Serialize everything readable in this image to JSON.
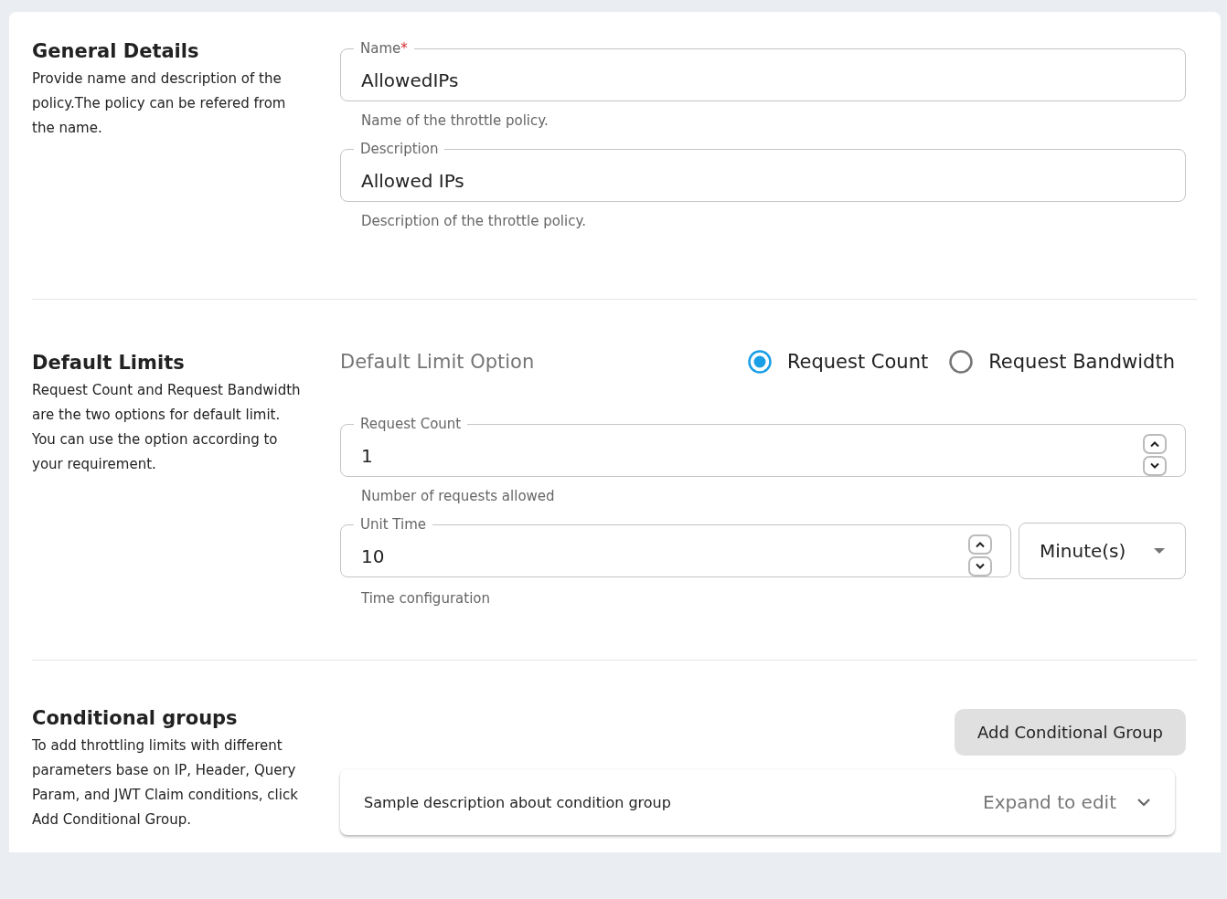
{
  "sections": [
    {
      "kind": "general",
      "title": "General Details",
      "description": "Provide name and description of the policy.The policy can be refered from the name.",
      "fields": [
        {
          "kind": "text",
          "label": "Name",
          "required_mark": "*",
          "value": "AllowedIPs",
          "helper": "Name of the throttle policy."
        },
        {
          "kind": "text",
          "label": "Description",
          "value": "Allowed IPs",
          "helper": "Description of the throttle policy."
        }
      ]
    },
    {
      "kind": "limits",
      "title": "Default Limits",
      "description": "Request Count and Request Bandwidth are the two options for default limit. You can use the option according to your requirement.",
      "radio_group": {
        "label": "Default Limit Option",
        "options": [
          {
            "label": "Request Count",
            "selected": true
          },
          {
            "label": "Request Bandwidth",
            "selected": false
          }
        ]
      },
      "fields": [
        {
          "kind": "number",
          "label": "Request Count",
          "value": "1",
          "helper": "Number of requests allowed"
        },
        {
          "kind": "number",
          "label": "Unit Time",
          "value": "10",
          "helper": "Time configuration",
          "unit": {
            "value": "Minute(s)"
          }
        }
      ]
    },
    {
      "kind": "groups",
      "title": "Conditional groups",
      "description": "To add throttling limits with different parameters base on IP, Header, Query Param, and JWT Claim conditions, click Add Conditional Group.",
      "button": "Add Conditional Group",
      "groups": [
        {
          "description": "Sample description about condition group",
          "action": "Expand to edit",
          "expanded": false
        }
      ]
    }
  ]
}
